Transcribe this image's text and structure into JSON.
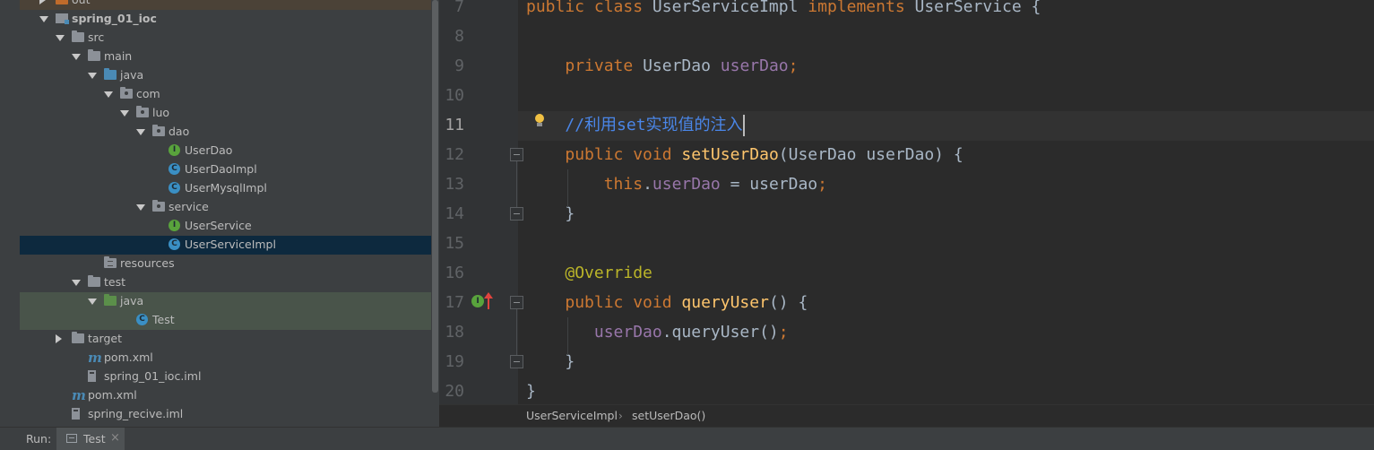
{
  "project_tree": {
    "rows": [
      {
        "label": "out",
        "icon": "folder-orange-icon",
        "depth": 1,
        "arrow": "right",
        "kind": "out"
      },
      {
        "label": "spring_01_ioc",
        "icon": "module-icon",
        "depth": 1,
        "arrow": "down",
        "kind": "module",
        "bold": true
      },
      {
        "label": "src",
        "icon": "folder-icon",
        "depth": 2,
        "arrow": "down"
      },
      {
        "label": "main",
        "icon": "folder-icon",
        "depth": 3,
        "arrow": "down"
      },
      {
        "label": "java",
        "icon": "source-folder-icon",
        "depth": 4,
        "arrow": "down",
        "kind": "src"
      },
      {
        "label": "com",
        "icon": "package-icon",
        "depth": 5,
        "arrow": "down",
        "kind": "pkg"
      },
      {
        "label": "luo",
        "icon": "package-icon",
        "depth": 6,
        "arrow": "down",
        "kind": "pkg"
      },
      {
        "label": "dao",
        "icon": "package-icon",
        "depth": 7,
        "arrow": "down",
        "kind": "pkg"
      },
      {
        "label": "UserDao",
        "icon": "interface-icon",
        "depth": 8,
        "arrow": "none",
        "kind": "interface"
      },
      {
        "label": "UserDaoImpl",
        "icon": "class-icon",
        "depth": 8,
        "arrow": "none",
        "kind": "class"
      },
      {
        "label": "UserMysqlImpl",
        "icon": "class-icon",
        "depth": 8,
        "arrow": "none",
        "kind": "class"
      },
      {
        "label": "service",
        "icon": "package-icon",
        "depth": 7,
        "arrow": "down",
        "kind": "pkg"
      },
      {
        "label": "UserService",
        "icon": "interface-icon",
        "depth": 8,
        "arrow": "none",
        "kind": "interface"
      },
      {
        "label": "UserServiceImpl",
        "icon": "class-icon",
        "depth": 8,
        "arrow": "none",
        "kind": "class",
        "selected": true
      },
      {
        "label": "resources",
        "icon": "resources-folder-icon",
        "depth": 4,
        "arrow": "none",
        "kind": "res"
      },
      {
        "label": "test",
        "icon": "folder-icon",
        "depth": 3,
        "arrow": "down"
      },
      {
        "label": "java",
        "icon": "test-source-folder-icon",
        "depth": 4,
        "arrow": "down",
        "kind": "testsrc",
        "highlight": true
      },
      {
        "label": "Test",
        "icon": "test-class-icon",
        "depth": 6,
        "arrow": "none",
        "kind": "class",
        "highlight": true
      },
      {
        "label": "target",
        "icon": "folder-icon",
        "depth": 2,
        "arrow": "right"
      },
      {
        "label": "pom.xml",
        "icon": "maven-icon",
        "depth": 3,
        "arrow": "none",
        "kind": "maven"
      },
      {
        "label": "spring_01_ioc.iml",
        "icon": "iml-file-icon",
        "depth": 3,
        "arrow": "none",
        "kind": "iml"
      },
      {
        "label": "pom.xml",
        "icon": "maven-icon",
        "depth": 2,
        "arrow": "none",
        "kind": "maven"
      },
      {
        "label": "spring_recive.iml",
        "icon": "iml-file-icon",
        "depth": 2,
        "arrow": "none",
        "kind": "iml"
      }
    ]
  },
  "editor": {
    "current_line": 11,
    "lines": [
      {
        "num": "7",
        "tokens": [
          [
            "kw",
            "public class "
          ],
          [
            "type",
            "UserServiceImpl "
          ],
          [
            "kw",
            "implements "
          ],
          [
            "type",
            "UserService "
          ],
          [
            "plain",
            "{"
          ]
        ]
      },
      {
        "num": "8",
        "tokens": []
      },
      {
        "num": "9",
        "tokens": [
          [
            "plain",
            "    "
          ],
          [
            "kw",
            "private "
          ],
          [
            "type",
            "UserDao "
          ],
          [
            "field",
            "userDao"
          ],
          [
            "kw",
            ";"
          ]
        ]
      },
      {
        "num": "10",
        "tokens": []
      },
      {
        "num": "11",
        "tokens": [
          [
            "plain",
            "    "
          ],
          [
            "comment-blue",
            "//利用set实现值的注入"
          ]
        ],
        "caret": true
      },
      {
        "num": "12",
        "tokens": [
          [
            "plain",
            "    "
          ],
          [
            "kw",
            "public void "
          ],
          [
            "meth",
            "setUserDao"
          ],
          [
            "plain",
            "(UserDao userDao) {"
          ]
        ]
      },
      {
        "num": "13",
        "tokens": [
          [
            "plain",
            "        "
          ],
          [
            "kw",
            "this"
          ],
          [
            "plain",
            "."
          ],
          [
            "field",
            "userDao "
          ],
          [
            "plain",
            "= userDao"
          ],
          [
            "kw",
            ";"
          ]
        ]
      },
      {
        "num": "14",
        "tokens": [
          [
            "plain",
            "    }"
          ]
        ]
      },
      {
        "num": "15",
        "tokens": []
      },
      {
        "num": "16",
        "tokens": [
          [
            "plain",
            "    "
          ],
          [
            "anno",
            "@Override"
          ]
        ]
      },
      {
        "num": "17",
        "tokens": [
          [
            "plain",
            "    "
          ],
          [
            "kw",
            "public void "
          ],
          [
            "meth",
            "queryUser"
          ],
          [
            "plain",
            "() {"
          ]
        ]
      },
      {
        "num": "18",
        "tokens": [
          [
            "plain",
            "       "
          ],
          [
            "field",
            "userDao"
          ],
          [
            "plain",
            ".queryUser()"
          ],
          [
            "kw",
            ";"
          ]
        ]
      },
      {
        "num": "19",
        "tokens": [
          [
            "plain",
            "    }"
          ]
        ]
      },
      {
        "num": "20",
        "tokens": [
          [
            "plain",
            "}"
          ]
        ]
      }
    ]
  },
  "breadcrumb": {
    "items": [
      "UserServiceImpl",
      "setUserDao()"
    ],
    "separator": "›"
  },
  "run_bar": {
    "label": "Run:",
    "tab_label": "Test",
    "close_glyph": "×"
  },
  "colors": {
    "keyword": "#cc7832",
    "method": "#ffc66d",
    "field": "#9876aa",
    "annotation": "#bbb529",
    "comment": "#4a86e8",
    "selection": "#0d293e"
  }
}
